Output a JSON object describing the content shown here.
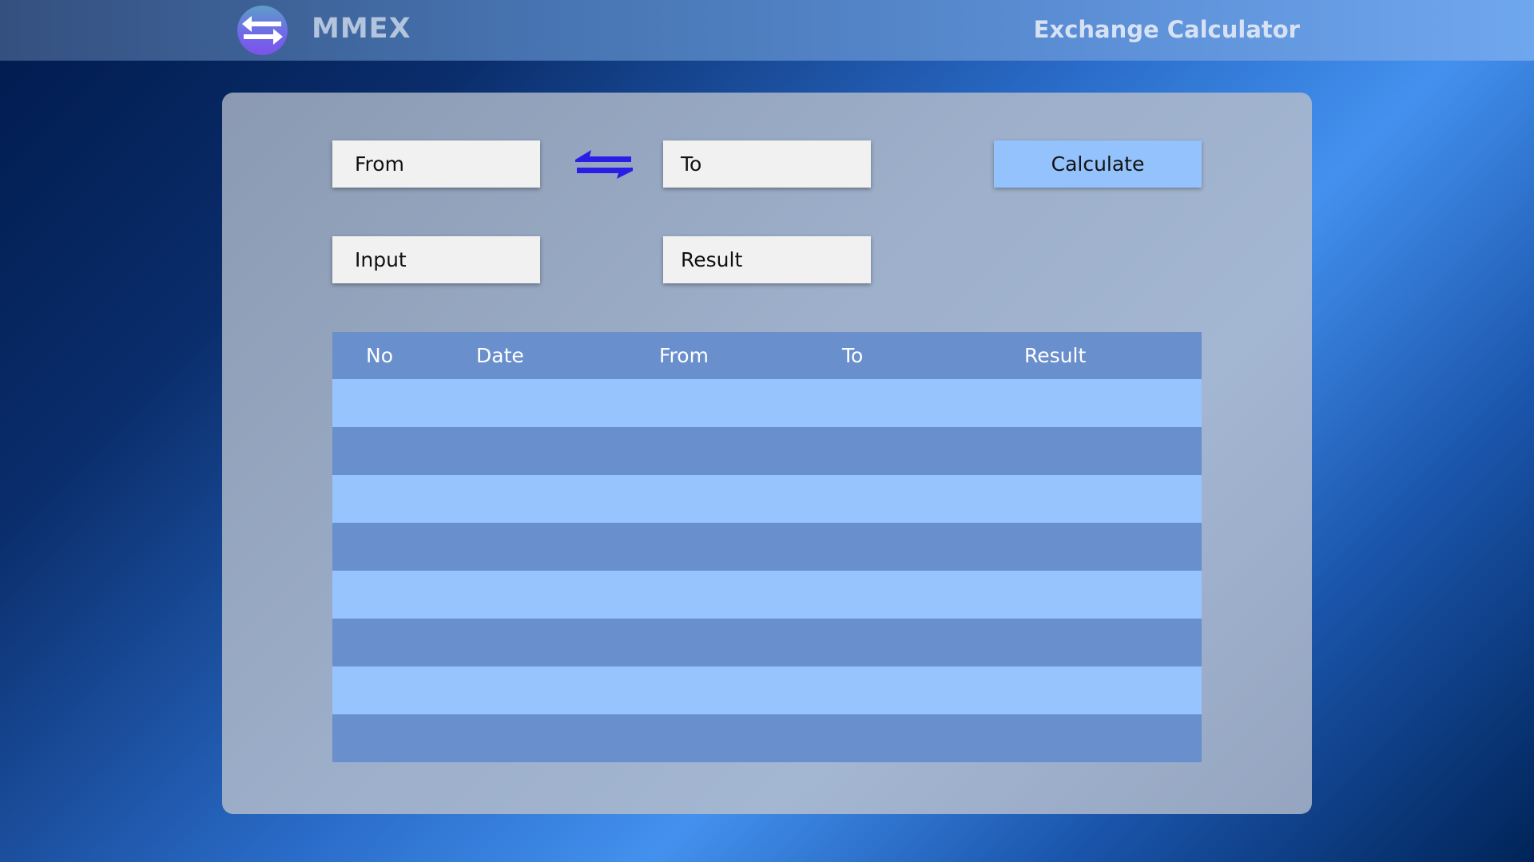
{
  "header": {
    "brand": "MMEX",
    "title": "Exchange Calculator",
    "logo_icon": "swap-arrows-icon"
  },
  "form": {
    "from_placeholder": "From",
    "to_placeholder": "To",
    "input_placeholder": "Input",
    "result_placeholder": "Result",
    "swap_icon": "swap-arrows-icon",
    "calculate_label": "Calculate"
  },
  "history_table": {
    "columns": [
      "No",
      "Date",
      "From",
      "To",
      "Result"
    ],
    "rows": [
      [
        "",
        "",
        "",
        "",
        ""
      ],
      [
        "",
        "",
        "",
        "",
        ""
      ],
      [
        "",
        "",
        "",
        "",
        ""
      ],
      [
        "",
        "",
        "",
        "",
        ""
      ],
      [
        "",
        "",
        "",
        "",
        ""
      ],
      [
        "",
        "",
        "",
        "",
        ""
      ],
      [
        "",
        "",
        "",
        "",
        ""
      ],
      [
        "",
        "",
        "",
        "",
        ""
      ]
    ]
  },
  "colors": {
    "accent_button": "#93c2fc",
    "table_header": "#698fcc",
    "row_light": "#97c4fd",
    "row_dark": "#698fcc",
    "swap_icon": "#2a1ee6"
  }
}
